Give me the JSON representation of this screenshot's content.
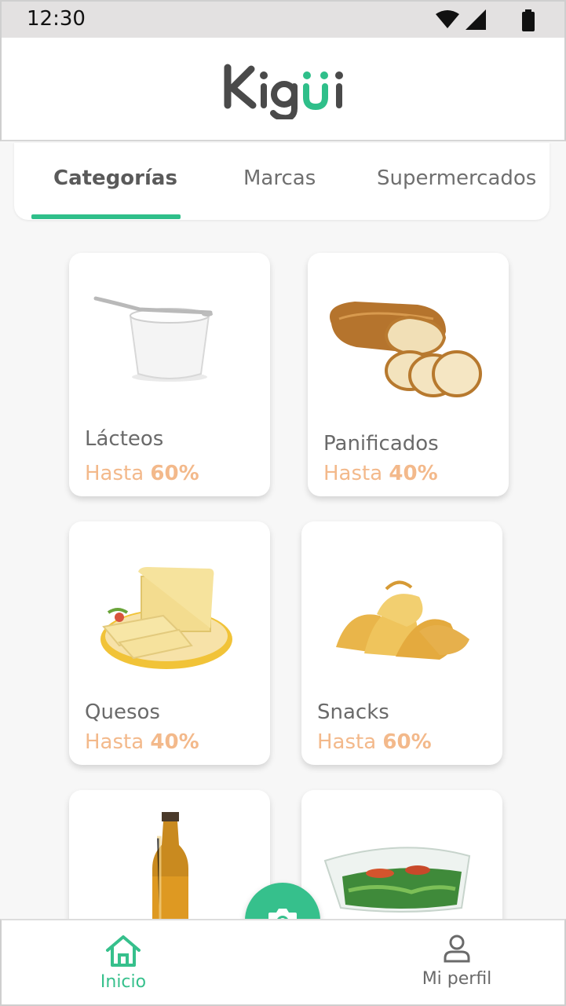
{
  "status_bar": {
    "time": "12:30"
  },
  "app": {
    "logo_text": "Kigüi",
    "accent_color": "#2fbf8a",
    "promo_color": "#f3b98b"
  },
  "tabs": [
    {
      "label": "Categorías",
      "active": true
    },
    {
      "label": "Marcas",
      "active": false
    },
    {
      "label": "Supermercados",
      "active": false
    }
  ],
  "categories": [
    {
      "name": "Lácteos",
      "promo_prefix": "Hasta",
      "promo_value": "60%",
      "image": "yogurt-cup"
    },
    {
      "name": "Panificados",
      "promo_prefix": "Hasta",
      "promo_value": "40%",
      "image": "bread-loaf"
    },
    {
      "name": "Quesos",
      "promo_prefix": "Hasta",
      "promo_value": "40%",
      "image": "cheese-plate"
    },
    {
      "name": "Snacks",
      "promo_prefix": "Hasta",
      "promo_value": "60%",
      "image": "potato-chips"
    },
    {
      "name": "",
      "promo_prefix": "",
      "promo_value": "",
      "image": "beer-bottle"
    },
    {
      "name": "",
      "promo_prefix": "",
      "promo_value": "",
      "image": "salad-container"
    }
  ],
  "bottom_nav": {
    "home_label": "Inicio",
    "profile_label": "Mi perfil",
    "camera_icon": "camera-icon"
  }
}
